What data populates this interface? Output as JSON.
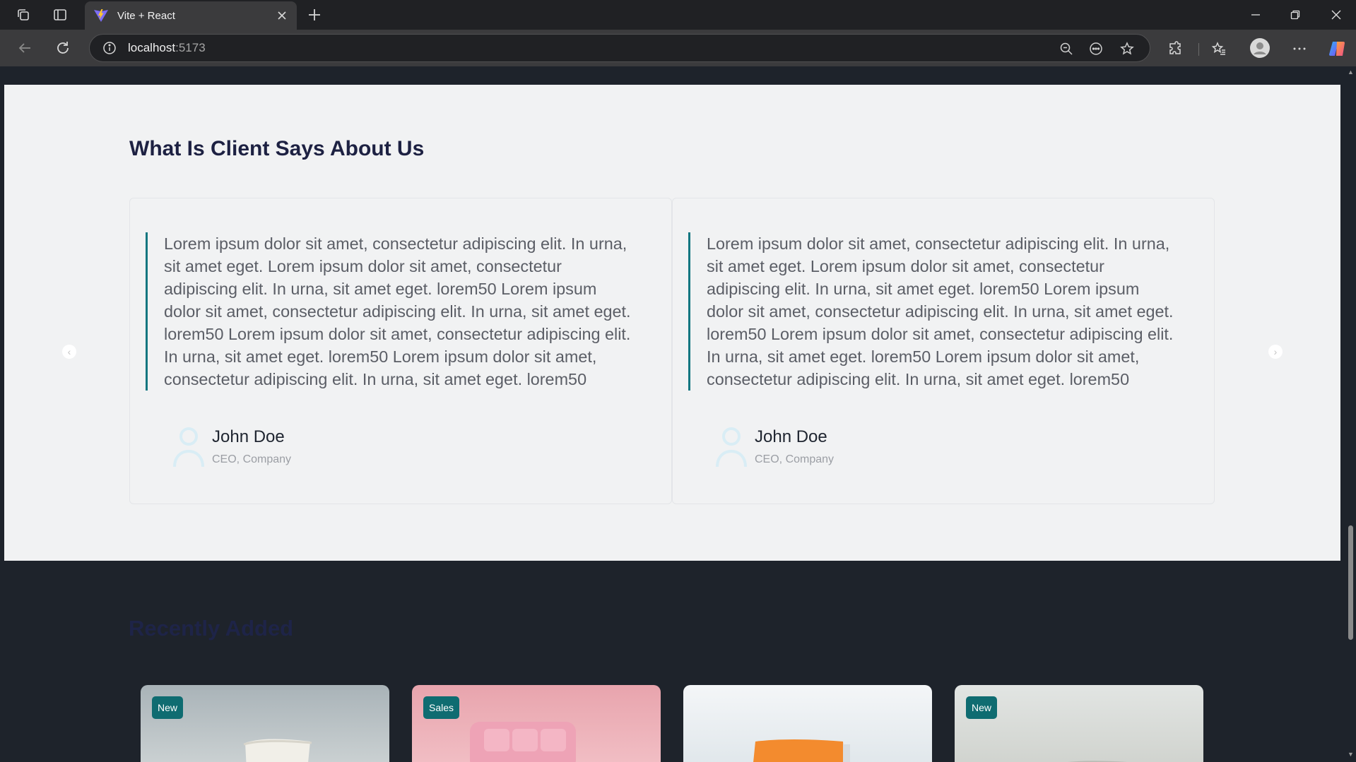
{
  "browser": {
    "tab_title": "Vite + React",
    "url_host": "localhost",
    "url_port": ":5173"
  },
  "testimonials": {
    "title": "What Is Client Says About Us",
    "items": [
      {
        "quote": "Lorem ipsum dolor sit amet, consectetur adipiscing elit. In urna, sit amet eget. Lorem ipsum dolor sit amet, consectetur adipiscing elit. In urna, sit amet eget. lorem50 Lorem ipsum dolor sit amet, consectetur adipiscing elit. In urna, sit amet eget. lorem50 Lorem ipsum dolor sit amet, consectetur adipiscing elit. In urna, sit amet eget. lorem50 Lorem ipsum dolor sit amet, consectetur adipiscing elit. In urna, sit amet eget. lorem50",
        "name": "John Doe",
        "role": "CEO, Company"
      },
      {
        "quote": "Lorem ipsum dolor sit amet, consectetur adipiscing elit. In urna, sit amet eget. Lorem ipsum dolor sit amet, consectetur adipiscing elit. In urna, sit amet eget. lorem50 Lorem ipsum dolor sit amet, consectetur adipiscing elit. In urna, sit amet eget. lorem50 Lorem ipsum dolor sit amet, consectetur adipiscing elit. In urna, sit amet eget. lorem50 Lorem ipsum dolor sit amet, consectetur adipiscing elit. In urna, sit amet eget. lorem50",
        "name": "John Doe",
        "role": "CEO, Company"
      }
    ]
  },
  "recent": {
    "title": "Recently Added",
    "products": [
      {
        "badge": "New",
        "image": "white-chair"
      },
      {
        "badge": "Sales",
        "image": "pink-armchair"
      },
      {
        "badge": "",
        "image": "orange-chair"
      },
      {
        "badge": "New",
        "image": "white-sofa"
      }
    ]
  },
  "colors": {
    "accent": "#127680",
    "badge_bg": "#0f6c71",
    "heading": "#1d2142",
    "page_dark": "#1e232b",
    "section_light": "#f1f2f3"
  }
}
